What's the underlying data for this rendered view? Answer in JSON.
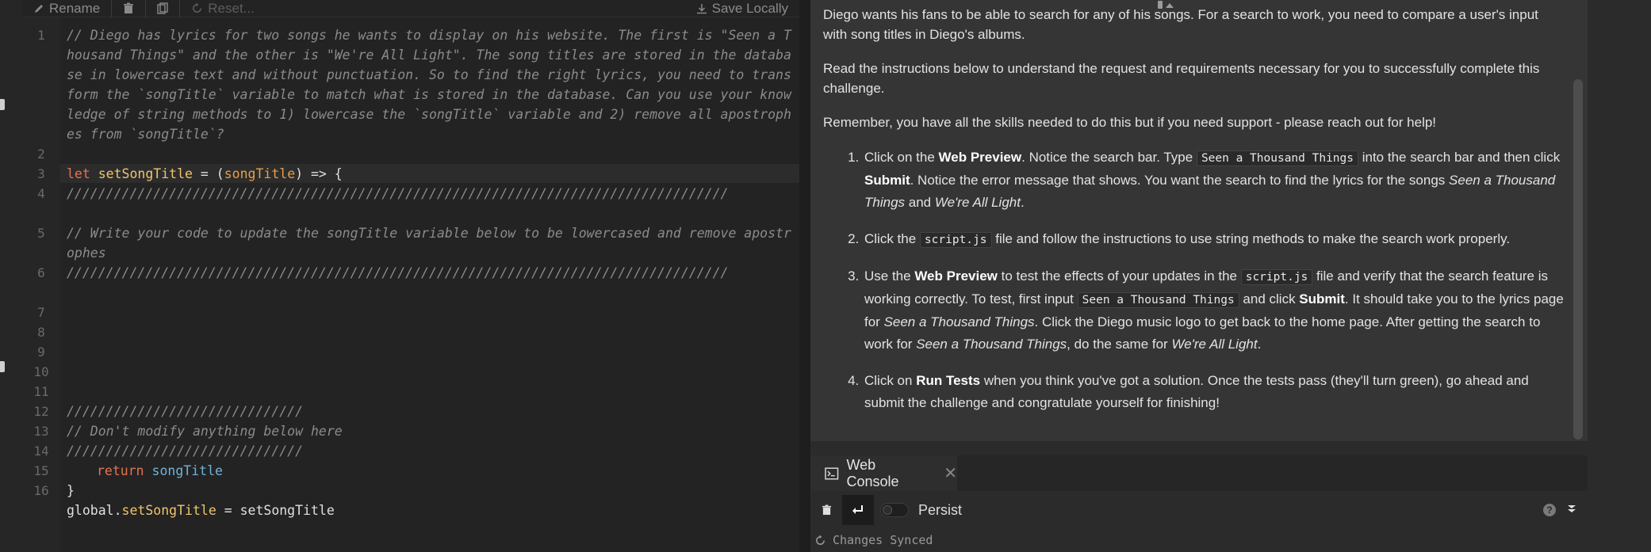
{
  "toolbar": {
    "rename_label": "Rename",
    "reset_label": "Reset...",
    "save_label": "Save Locally"
  },
  "code_lines": [
    {
      "n": "1",
      "text": "// Diego has lyrics for two songs he wants to display on his website. The first is \"Seen a Thousand Things\" and the other is \"We're All Light\". The song titles are stored in the database in lowercase text and without punctuation. So to find the right lyrics, you need to transform the `songTitle` variable to match what is stored in the database. Can you use your knowledge of string methods to 1) lowercase the `songTitle` variable and 2) remove all apostrophes from `songTitle`?"
    },
    {
      "n": "2",
      "text": ""
    },
    {
      "n": "3",
      "parts": {
        "kw": "let",
        "fn": "setSongTitle",
        "eq": " = (",
        "param": "songTitle",
        "rest": ") => {"
      }
    },
    {
      "n": "4",
      "text": "////////////////////////////////////////////////////////////////////////////////////"
    },
    {
      "n": "5",
      "text": "// Write your code to update the songTitle variable below to be lowercased and remove apostrophes"
    },
    {
      "n": "6",
      "text": "////////////////////////////////////////////////////////////////////////////////////"
    },
    {
      "n": "7",
      "text": ""
    },
    {
      "n": "8",
      "text": ""
    },
    {
      "n": "9",
      "text": ""
    },
    {
      "n": "10",
      "text": ""
    },
    {
      "n": "11",
      "text": "//////////////////////////////"
    },
    {
      "n": "12",
      "text": "// Don't modify anything below here"
    },
    {
      "n": "13",
      "text": "//////////////////////////////"
    },
    {
      "n": "14",
      "parts": {
        "kw": "return",
        "id": "songTitle"
      }
    },
    {
      "n": "15",
      "text": "}"
    },
    {
      "n": "16",
      "parts": {
        "obj": "global.",
        "prop": "setSongTitle",
        "eq": " = ",
        "val": "setSongTitle"
      }
    }
  ],
  "instructions": {
    "p1": "Diego wants his fans to be able to search for any of his songs. For a search to work, you need to compare a user's input with song titles in Diego's albums.",
    "p2": "Read the instructions below to understand the request and requirements necessary for you to successfully complete this challenge.",
    "p3": "Remember, you have all the skills needed to do this but if you need support - please reach out for help!",
    "s1": {
      "a": "Click on the ",
      "b": "Web Preview",
      "c": ". Notice the search bar. Type ",
      "code": "Seen a Thousand Things",
      "d": " into the search bar and then click ",
      "e": "Submit",
      "f": ". Notice the error message that shows. You want the search to find the lyrics for the songs ",
      "g": "Seen a Thousand Things",
      "h": " and ",
      "i": "We're All Light",
      "j": "."
    },
    "s2": {
      "a": "Click the ",
      "code": "script.js",
      "b": " file and follow the instructions to use string methods to make the search work properly."
    },
    "s3": {
      "a": "Use the ",
      "b": "Web Preview",
      "c": " to test the effects of your updates in the ",
      "code1": "script.js",
      "d": " file and verify that the search feature is working correctly. To test, first input ",
      "code2": "Seen a Thousand Things",
      "e": " and click ",
      "f": "Submit",
      "g": ". It should take you to the lyrics page for ",
      "h": "Seen a Thousand Things",
      "i": ". Click the Diego music logo to get back to the home page. After getting the search to work for ",
      "j": "Seen a Thousand Things",
      "k": ", do the same for ",
      "l": "We're All Light",
      "m": "."
    },
    "s4": {
      "a": "Click on ",
      "b": "Run Tests",
      "c": " when you think you've got a solution. Once the tests pass (they'll turn green), go ahead and submit the challenge and congratulate yourself for finishing!"
    }
  },
  "console": {
    "tab_label": "Web Console",
    "persist_label": "Persist",
    "help_glyph": "?"
  },
  "status": {
    "text": "Changes Synced"
  }
}
